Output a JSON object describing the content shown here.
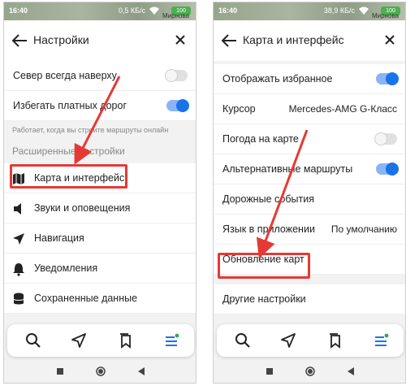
{
  "statusbar": {
    "left_time": "16:40",
    "left_speed": "0,5 КБ/с",
    "left_battery": "100",
    "left_mapword": "Мирнова",
    "right_time": "16:40",
    "right_speed": "38,9 КБ/с",
    "right_battery": "100",
    "right_mapword": "Мирнова"
  },
  "left_screen": {
    "title": "Настройки",
    "rows": [
      {
        "label": "Север всегда наверху",
        "toggle": "off"
      },
      {
        "label": "Избегать платных дорог",
        "toggle": "on"
      }
    ],
    "hint": "Работает, когда вы строите маршруты онлайн",
    "section": "Расширенные настройки",
    "items": [
      {
        "label": "Карта и интерфейс",
        "icon": "map-icon"
      },
      {
        "label": "Звуки и оповещения",
        "icon": "speaker-icon"
      },
      {
        "label": "Навигация",
        "icon": "navigation-arrow-icon"
      },
      {
        "label": "Уведомления",
        "icon": "bell-icon"
      },
      {
        "label": "Сохраненные данные",
        "icon": "storage-icon"
      }
    ]
  },
  "right_screen": {
    "title": "Карта и интерфейс",
    "rows": [
      {
        "label": "Отображать избранное",
        "toggle": "on",
        "value": ""
      },
      {
        "label": "Курсор",
        "toggle": "",
        "value": "Mercedes-AMG G-Класс"
      },
      {
        "label": "Погода на карте",
        "toggle": "off",
        "value": ""
      },
      {
        "label": "Альтернативные маршруты",
        "toggle": "on",
        "value": ""
      },
      {
        "label": "Дорожные события",
        "toggle": "",
        "value": ""
      },
      {
        "label": "Язык в приложении",
        "toggle": "",
        "value": "По умолчанию"
      },
      {
        "label": "Обновление карт",
        "toggle": "",
        "value": ""
      }
    ],
    "other": "Другие настройки"
  },
  "colors": {
    "accent": "#1a73e8",
    "highlight": "#e53935",
    "dot_green": "#34a853"
  }
}
